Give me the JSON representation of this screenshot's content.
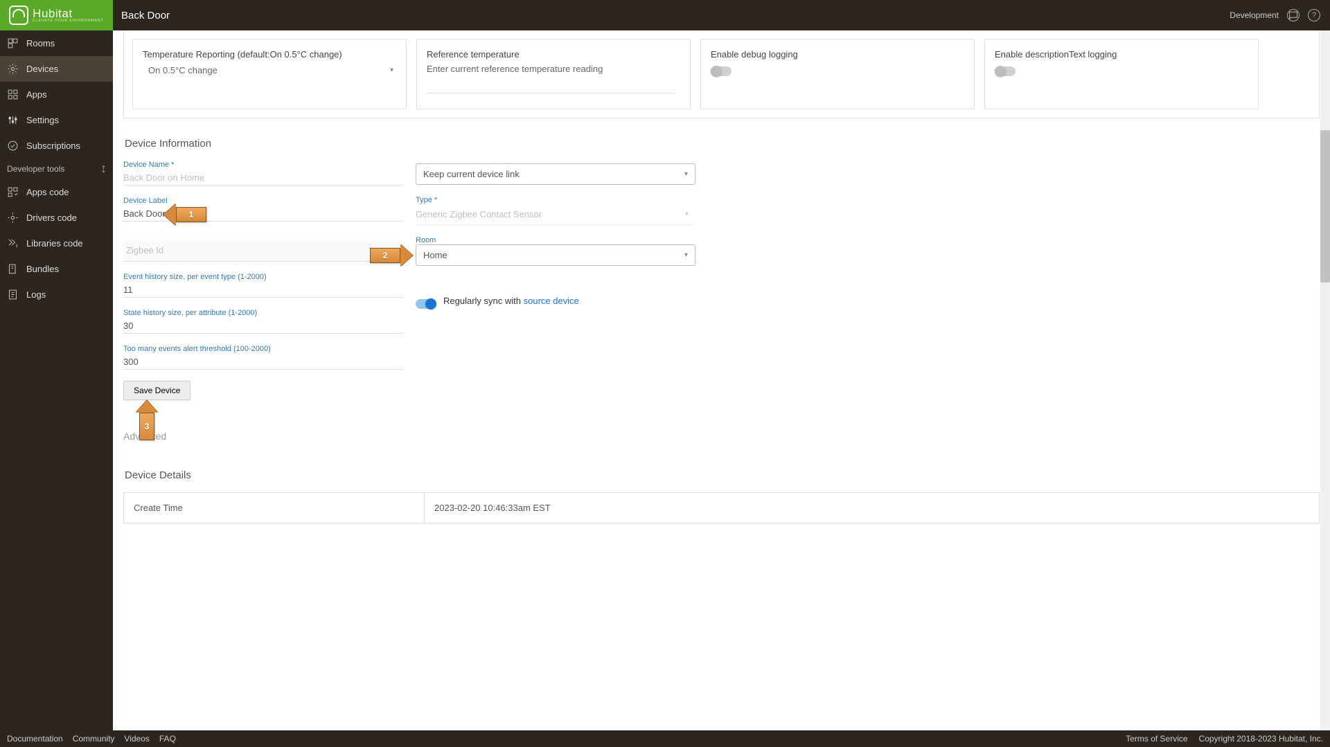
{
  "header": {
    "brand": "Hubitat",
    "tagline": "ELEVATE YOUR ENVIRONMENT",
    "page_title": "Back Door",
    "env": "Development"
  },
  "sidebar": {
    "items": [
      {
        "label": "Rooms",
        "active": false
      },
      {
        "label": "Devices",
        "active": true
      },
      {
        "label": "Apps",
        "active": false
      },
      {
        "label": "Settings",
        "active": false
      },
      {
        "label": "Subscriptions",
        "active": false
      }
    ],
    "dev_header": "Developer tools",
    "dev_items": [
      {
        "label": "Apps code"
      },
      {
        "label": "Drivers code"
      },
      {
        "label": "Libraries code"
      },
      {
        "label": "Bundles"
      },
      {
        "label": "Logs"
      }
    ]
  },
  "prefs": {
    "temp_report_label": "Temperature Reporting (default:On 0.5°C change)",
    "temp_report_value": "On 0.5°C change",
    "ref_temp_label": "Reference temperature",
    "ref_temp_hint": "Enter current reference temperature reading",
    "debug_label": "Enable debug logging",
    "desc_label": "Enable descriptionText logging"
  },
  "info": {
    "title": "Device Information",
    "device_name_label": "Device Name *",
    "device_name_value": "Back Door on Home",
    "device_label_label": "Device Label",
    "device_label_value": "Back Door",
    "zigbee_label": "Zigbee Id",
    "zigbee_value": "",
    "evt_hist_label": "Event history size, per event type (1-2000)",
    "evt_hist_value": "11",
    "state_hist_label": "State history size, per attribute (1-2000)",
    "state_hist_value": "30",
    "too_many_label": "Too many events alert threshold (100-2000)",
    "too_many_value": "300",
    "link_select": "Keep current device link",
    "type_label": "Type *",
    "type_value": "Generic Zigbee Contact Sensor",
    "room_label": "Room",
    "room_value": "Home",
    "sync_text": "Regularly sync with ",
    "sync_link": "source device",
    "save_btn": "Save Device",
    "advanced": "Advanced"
  },
  "details": {
    "title": "Device Details",
    "rows": [
      {
        "k": "Create Time",
        "v": "2023-02-20 10:46:33am EST"
      }
    ]
  },
  "footer": {
    "links": [
      "Documentation",
      "Community",
      "Videos",
      "FAQ"
    ],
    "tos": "Terms of Service",
    "copyright": "Copyright 2018-2023 Hubitat, Inc."
  },
  "annotations": {
    "a1": "1",
    "a2": "2",
    "a3": "3"
  }
}
